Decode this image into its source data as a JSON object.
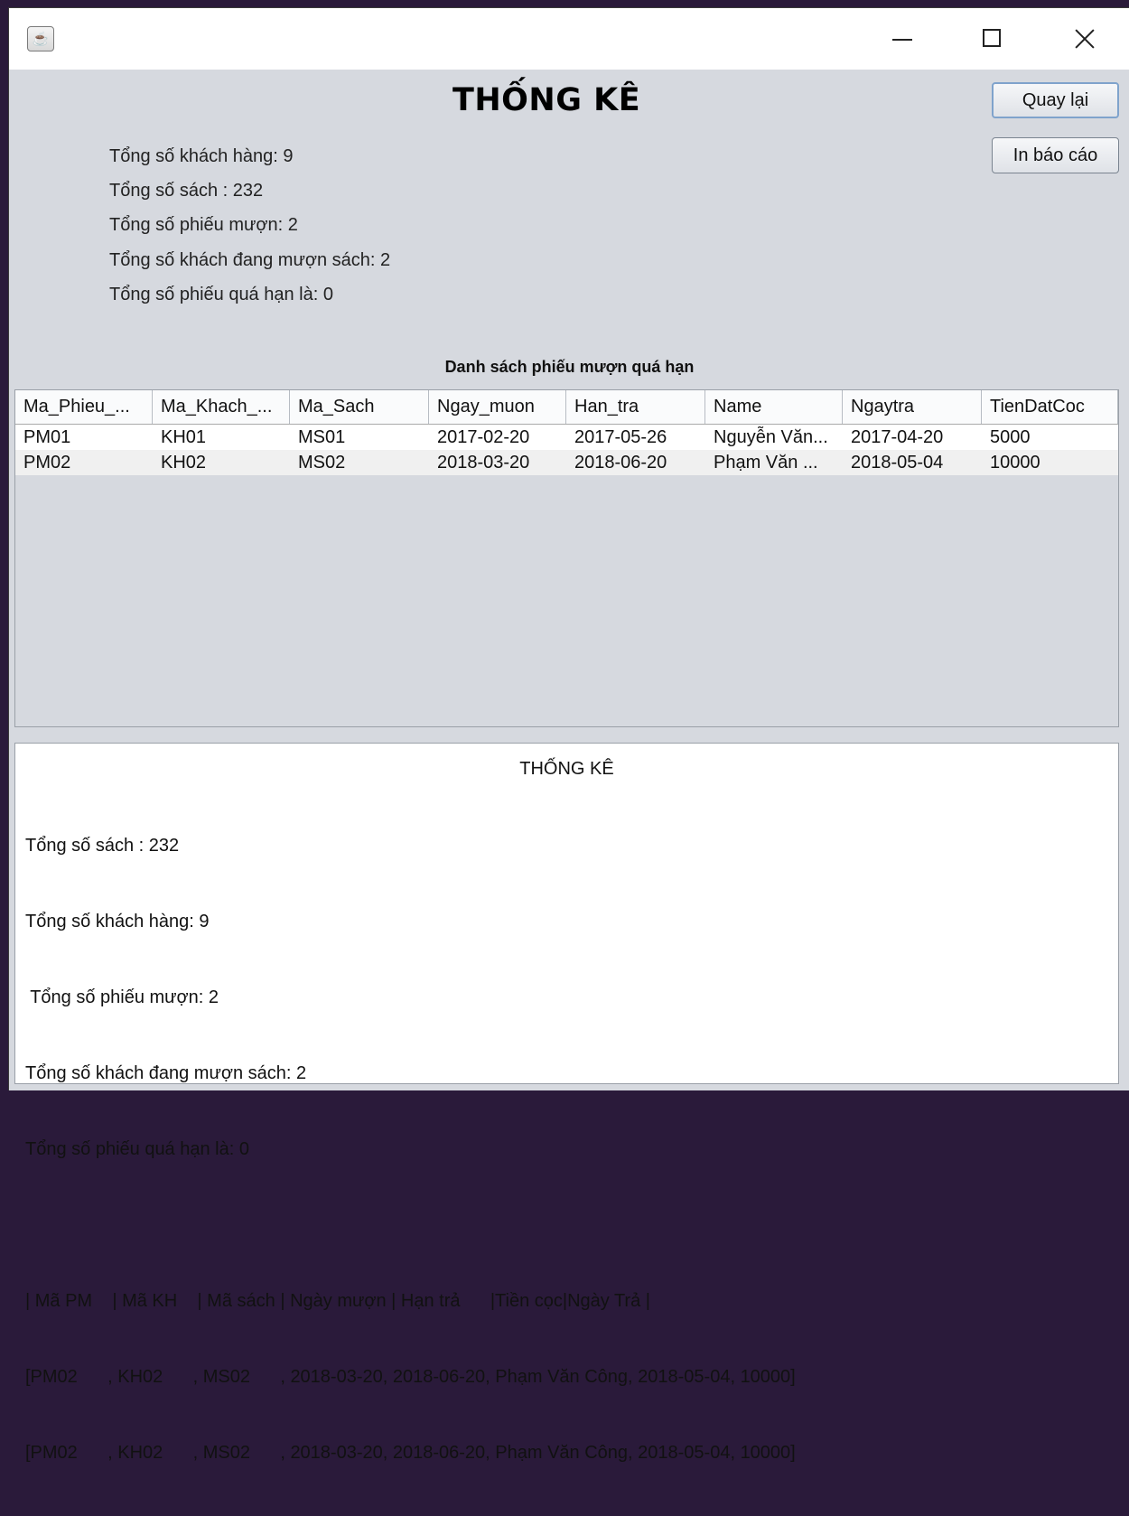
{
  "window": {
    "app_icon": "java-cup-icon"
  },
  "header": {
    "title": "THỐNG KÊ",
    "back_button": "Quay lại",
    "print_button": "In báo cáo"
  },
  "stats": [
    "Tổng số khách hàng: 9",
    "Tổng số sách : 232",
    " Tổng số phiếu mượn: 2",
    "Tổng số khách đang mượn sách: 2",
    "Tổng số phiếu quá hạn là: 0"
  ],
  "overdue": {
    "label": "Danh sách phiếu mượn quá hạn",
    "columns": [
      "Ma_Phieu_...",
      "Ma_Khach_...",
      "Ma_Sach",
      "Ngay_muon",
      "Han_tra",
      "Name",
      "Ngaytra",
      "TienDatCoc"
    ],
    "rows": [
      [
        "PM01",
        "KH01",
        "MS01",
        "2017-02-20",
        "2017-05-26",
        "Nguyễn Văn...",
        "2017-04-20",
        "5000"
      ],
      [
        "PM02",
        "KH02",
        "MS02",
        "2018-03-20",
        "2018-06-20",
        "Phạm Văn ...",
        "2018-05-04",
        "10000"
      ]
    ]
  },
  "report": {
    "title": "THỐNG KÊ",
    "lines": [
      "Tổng số sách : 232",
      "Tổng số khách hàng: 9",
      " Tổng số phiếu mượn: 2",
      "Tổng số khách đang mượn sách: 2",
      "Tổng số phiếu quá hạn là: 0",
      "",
      "| Mã PM    | Mã KH    | Mã sách | Ngày mượn | Hạn trả      |Tiền cọc|Ngày Trả |",
      "[PM02      , KH02      , MS02      , 2018-03-20, 2018-06-20, Phạm Văn Công, 2018-05-04, 10000]",
      "[PM02      , KH02      , MS02      , 2018-03-20, 2018-06-20, Phạm Văn Công, 2018-05-04, 10000]"
    ]
  }
}
